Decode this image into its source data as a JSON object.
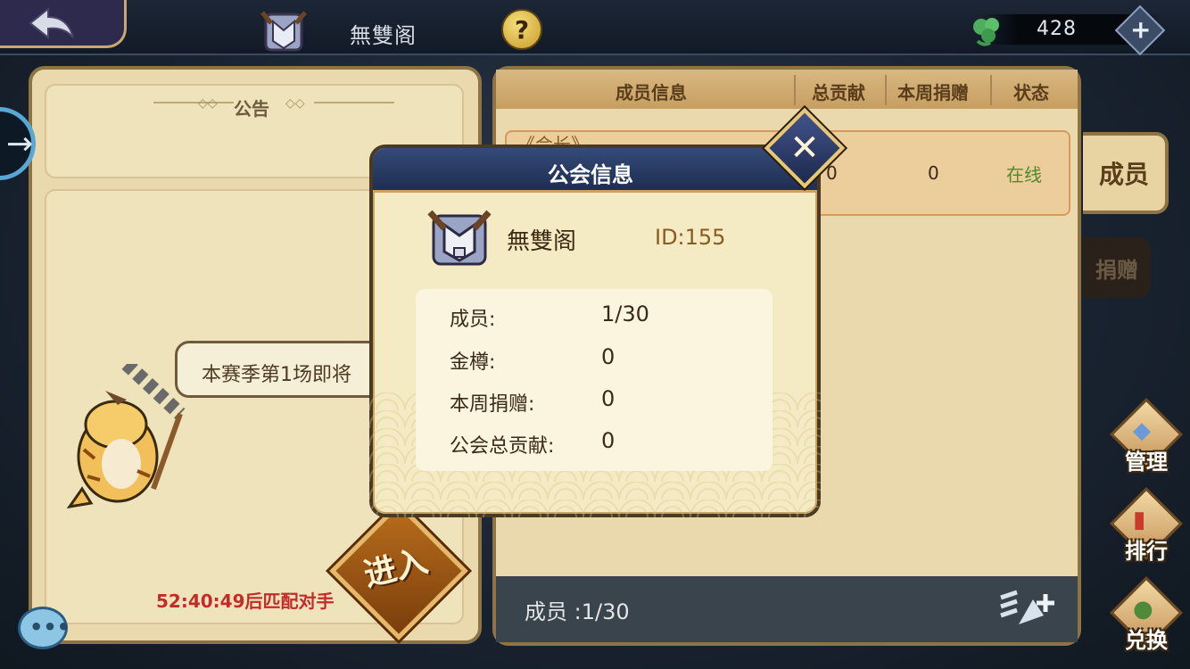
{
  "top_bar": {
    "title": "無雙阁",
    "help_label": "?",
    "currency_value": "428",
    "add_label": "+"
  },
  "notice": {
    "title": "公告",
    "speech": "本赛季第1场即将",
    "countdown": "52:40:49后匹配对手",
    "enter_label": "进入"
  },
  "members_table": {
    "headers": [
      "成员信息",
      "总贡献",
      "本周捐赠",
      "状态"
    ],
    "rows": [
      {
        "name": "《会长》",
        "total": "0",
        "weekly": "0",
        "status": "在线"
      }
    ],
    "footer": "成员 :1/30"
  },
  "side_tabs": [
    "成员",
    "捐赠"
  ],
  "side_actions": [
    "管理",
    "排行",
    "兑换"
  ],
  "modal": {
    "title": "公会信息",
    "close_label": "✕",
    "guild_name": "無雙阁",
    "guild_id": "ID:155",
    "fields": [
      {
        "label": "成员:",
        "value": "1/30"
      },
      {
        "label": "金樽:",
        "value": "0"
      },
      {
        "label": "本周捐赠:",
        "value": "0"
      },
      {
        "label": "公会总贡献:",
        "value": "0"
      }
    ]
  },
  "colors": {
    "panel": "#e9d9ad",
    "modal_header": "#25365e",
    "online_status": "#4f8a2a",
    "countdown": "#c42b2b"
  }
}
